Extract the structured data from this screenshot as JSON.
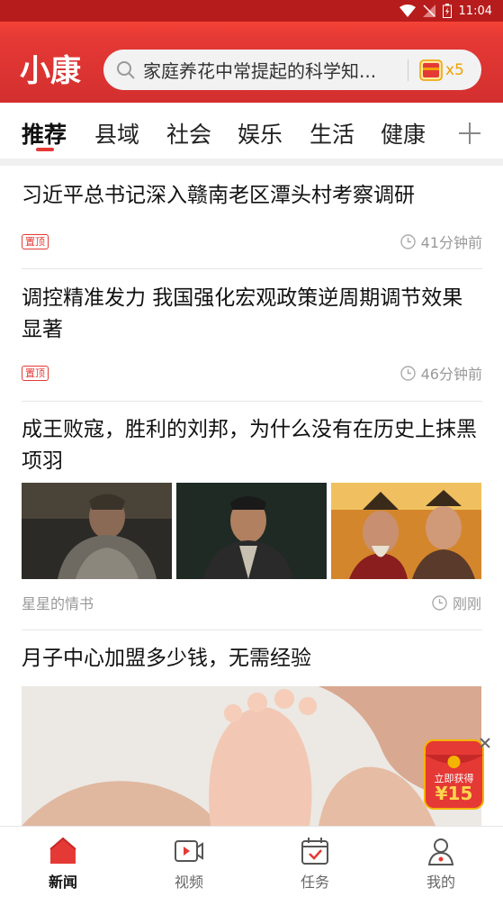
{
  "status_bar": {
    "time": "11:04"
  },
  "header": {
    "logo_text": "小康",
    "search_placeholder": "家庭养花中常提起的科学知...",
    "redpack_count": "x5"
  },
  "tabs": [
    {
      "label": "推荐",
      "active": true
    },
    {
      "label": "县域"
    },
    {
      "label": "社会"
    },
    {
      "label": "娱乐"
    },
    {
      "label": "生活"
    },
    {
      "label": "健康"
    }
  ],
  "feed": [
    {
      "title": "习近平总书记深入赣南老区潭头村考察调研",
      "badge": "置顶",
      "time": "41分钟前"
    },
    {
      "title": "调控精准发力 我国强化宏观政策逆周期调节效果显著",
      "badge": "置顶",
      "time": "46分钟前"
    },
    {
      "title": "成王败寇，胜利的刘邦，为什么没有在历史上抹黑项羽",
      "source": "星星的情书",
      "time": "刚刚"
    },
    {
      "title": "月子中心加盟多少钱，无需经验"
    }
  ],
  "promo": {
    "line1": "立即获得",
    "amount": "¥15"
  },
  "bottom_nav": [
    {
      "label": "新闻",
      "active": true
    },
    {
      "label": "视频"
    },
    {
      "label": "任务"
    },
    {
      "label": "我的"
    }
  ],
  "colors": {
    "brand_red": "#e53935",
    "header_dark": "#d32f2f",
    "gold": "#f0a000"
  }
}
